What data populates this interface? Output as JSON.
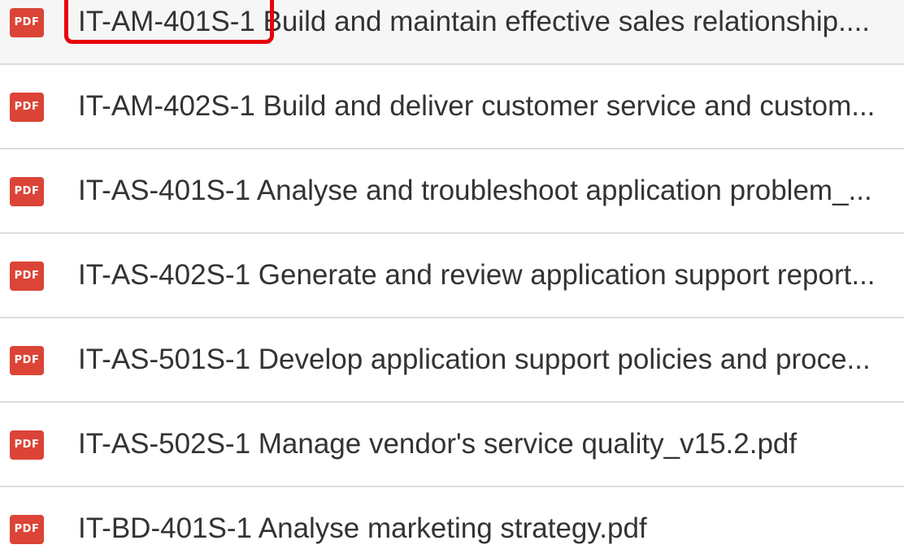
{
  "file_list": {
    "files": [
      {
        "name": "IT-AM-401S-1 Build and maintain effective sales relationship....",
        "icon": "pdf-icon",
        "icon_label": "PDF",
        "highlighted": true
      },
      {
        "name": "IT-AM-402S-1 Build and deliver customer service and custom...",
        "icon": "pdf-icon",
        "icon_label": "PDF"
      },
      {
        "name": "IT-AS-401S-1 Analyse and troubleshoot application problem_...",
        "icon": "pdf-icon",
        "icon_label": "PDF"
      },
      {
        "name": "IT-AS-402S-1 Generate and review application support report...",
        "icon": "pdf-icon",
        "icon_label": "PDF"
      },
      {
        "name": "IT-AS-501S-1 Develop application support policies and proce...",
        "icon": "pdf-icon",
        "icon_label": "PDF"
      },
      {
        "name": "IT-AS-502S-1 Manage vendor's service quality_v15.2.pdf",
        "icon": "pdf-icon",
        "icon_label": "PDF"
      },
      {
        "name": "IT-BD-401S-1 Analyse marketing strategy.pdf",
        "icon": "pdf-icon",
        "icon_label": "PDF"
      }
    ]
  },
  "colors": {
    "pdf_icon": "#db4437",
    "highlight_box": "#e8000b",
    "divider": "#dcdcdc",
    "text": "#333333"
  }
}
